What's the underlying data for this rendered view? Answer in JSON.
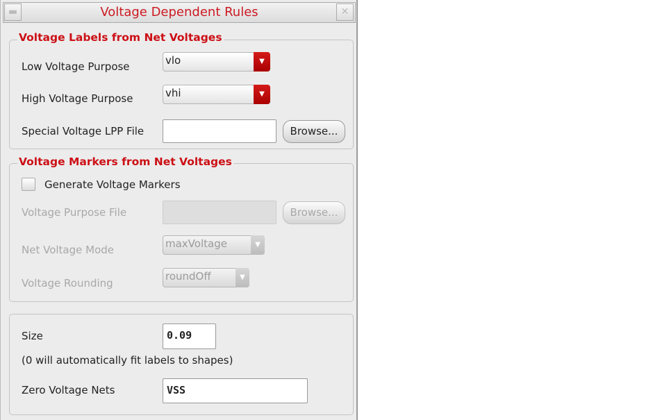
{
  "window": {
    "title": "Voltage Dependent Rules"
  },
  "labels_group": {
    "legend": "Voltage Labels from Net Voltages",
    "low_label": "Low Voltage Purpose",
    "low_value": "vlo",
    "high_label": "High Voltage Purpose",
    "high_value": "vhi",
    "lpp_label": "Special Voltage LPP File",
    "lpp_value": "",
    "browse": "Browse..."
  },
  "markers_group": {
    "legend": "Voltage Markers from Net Voltages",
    "generate_label": "Generate Voltage Markers",
    "generate_checked": false,
    "purpose_file_label": "Voltage Purpose File",
    "purpose_file_value": "",
    "browse": "Browse...",
    "mode_label": "Net Voltage Mode",
    "mode_value": "maxVoltage",
    "rounding_label": "Voltage Rounding",
    "rounding_value": "roundOff"
  },
  "size_group": {
    "size_label": "Size",
    "size_value": "0.09",
    "note": "(0 will automatically fit labels to shapes)",
    "zero_label": "Zero Voltage Nets",
    "zero_value": "VSS"
  },
  "colors": {
    "accent": "#cc1016",
    "background": "#ececec"
  }
}
